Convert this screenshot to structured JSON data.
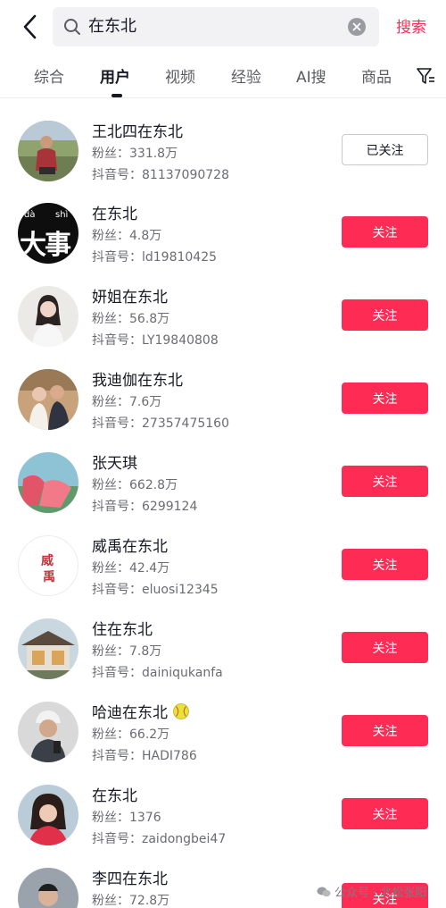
{
  "search": {
    "query": "在东北",
    "submit_label": "搜索"
  },
  "tabs": [
    {
      "label": "综合"
    },
    {
      "label": "用户"
    },
    {
      "label": "视频"
    },
    {
      "label": "经验"
    },
    {
      "label": "AI搜"
    },
    {
      "label": "商品"
    }
  ],
  "users": [
    {
      "name": "王北四在东北",
      "fans": "粉丝：331.8万",
      "id": "抖音号：81137090728",
      "button": "已关注"
    },
    {
      "name": "在东北",
      "fans": "粉丝：4.8万",
      "id": "抖音号：ld19810425",
      "button": "关注",
      "avatar_text": "大事",
      "avatar_pinyin_left": "dà",
      "avatar_pinyin_right": "shì"
    },
    {
      "name": "妍姐在东北",
      "fans": "粉丝：56.8万",
      "id": "抖音号：LY19840808",
      "button": "关注"
    },
    {
      "name": "我迪伽在东北",
      "fans": "粉丝：7.6万",
      "id": "抖音号：27357475160",
      "button": "关注"
    },
    {
      "name": "张天琪",
      "fans": "粉丝：662.8万",
      "id": "抖音号：6299124",
      "button": "关注"
    },
    {
      "name": "威禹在东北",
      "fans": "粉丝：42.4万",
      "id": "抖音号：eluosi12345",
      "button": "关注",
      "avatar_text_1": "威",
      "avatar_text_2": "禹"
    },
    {
      "name": "住在东北",
      "fans": "粉丝：7.8万",
      "id": "抖音号：dainiqukanfa",
      "button": "关注"
    },
    {
      "name": "哈迪在东北",
      "fans": "粉丝：66.2万",
      "id": "抖音号：HADI786",
      "button": "关注"
    },
    {
      "name": "在东北",
      "fans": "粉丝：1376",
      "id": "抖音号：zaidongbei47",
      "button": "关注"
    },
    {
      "name": "李四在东北",
      "fans": "粉丝：72.8万",
      "id": "",
      "button": "关注"
    }
  ],
  "watermark": "公众号 · 北松张阳",
  "colors": {
    "accent": "#fe2c55",
    "text": "#161823",
    "secondary": "#6b6c73"
  }
}
